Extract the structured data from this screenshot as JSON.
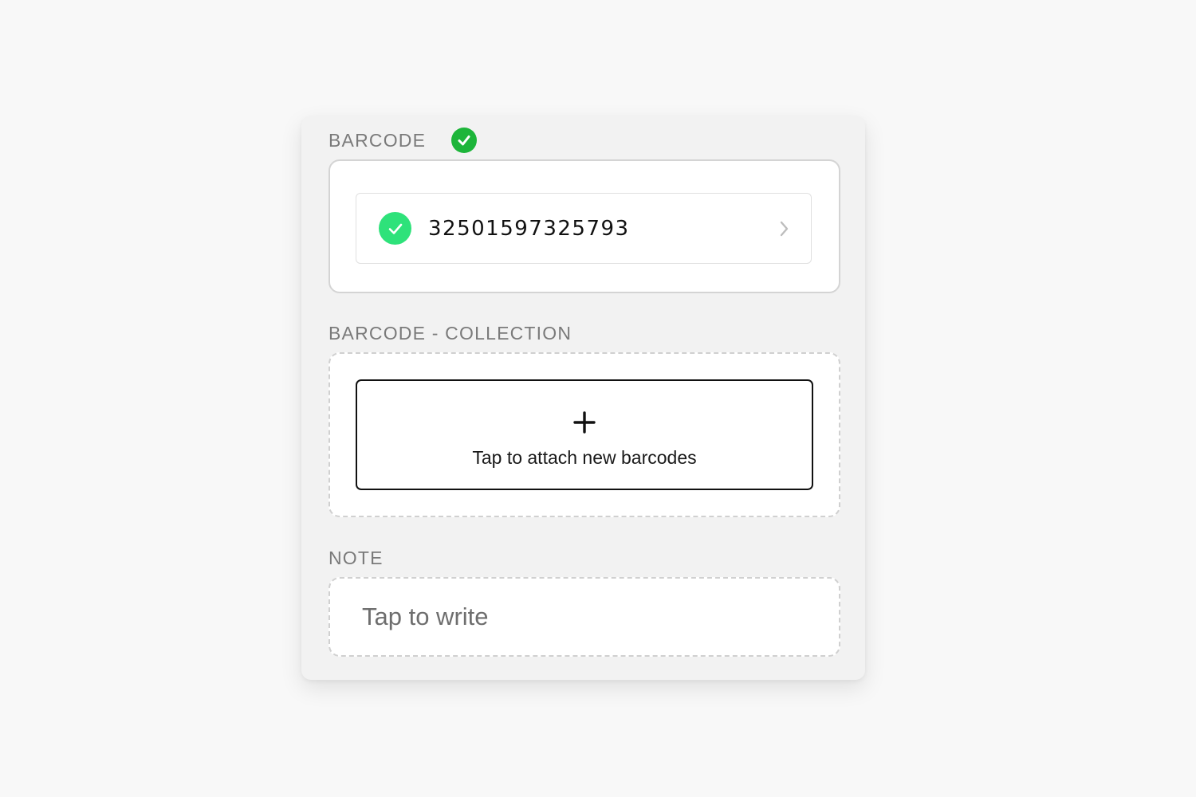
{
  "barcode_section": {
    "label": "BARCODE",
    "status_icon": "check-circle-icon",
    "item": {
      "value": "32501597325793",
      "icon": "check-circle-icon",
      "trailing_icon": "chevron-right-icon"
    }
  },
  "collection_section": {
    "label": "BARCODE - COLLECTION",
    "attach_icon": "plus-icon",
    "attach_label": "Tap to attach new barcodes"
  },
  "note_section": {
    "label": "NOTE",
    "placeholder": "Tap to write"
  },
  "colors": {
    "status_green": "#1db53a",
    "item_check_green": "#2ee27a",
    "label_gray": "#7a7a7a"
  }
}
